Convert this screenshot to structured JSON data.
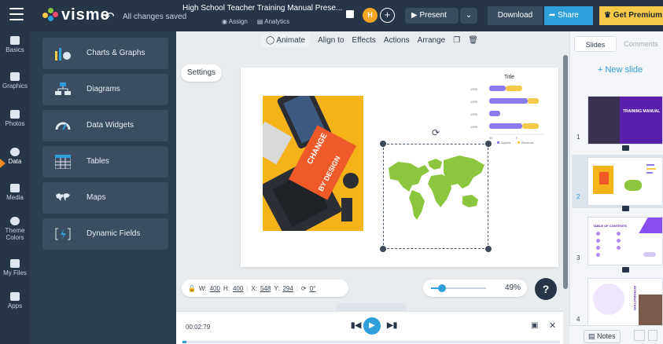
{
  "app": {
    "logo": "visme",
    "save_status": "All changes saved",
    "doc_title": "High School Teacher Training Manual Prese...",
    "assign_label": "Assign",
    "analytics_label": "Analytics",
    "avatar_initial": "H",
    "present_label": "Present",
    "download_label": "Download",
    "share_label": "Share",
    "premium_label": "Get Premium"
  },
  "sidebar": {
    "items": [
      {
        "label": "Basics"
      },
      {
        "label": "Graphics"
      },
      {
        "label": "Photos"
      },
      {
        "label": "Data"
      },
      {
        "label": "Media"
      },
      {
        "label": "Theme Colors"
      },
      {
        "label": "My Files"
      },
      {
        "label": "Apps"
      }
    ],
    "active": "Data"
  },
  "data_panel": {
    "items": [
      {
        "label": "Charts & Graphs"
      },
      {
        "label": "Diagrams"
      },
      {
        "label": "Data Widgets"
      },
      {
        "label": "Tables"
      },
      {
        "label": "Maps"
      },
      {
        "label": "Dynamic Fields"
      }
    ]
  },
  "context_toolbar": {
    "animate": "Animate",
    "align_to": "Align to",
    "effects": "Effects",
    "actions": "Actions",
    "arrange": "Arrange"
  },
  "canvas": {
    "settings_label": "Settings",
    "photo_text_1": "CHANGE",
    "photo_text_2": "BY DESIGN",
    "mini_chart": {
      "title": "Title",
      "categories": [
        "1994",
        "1995",
        "1996",
        "1999"
      ],
      "series": [
        {
          "values": [
            3,
            7,
            2,
            6
          ],
          "color": "#8a7cf0"
        },
        {
          "values": [
            3,
            2,
            0,
            3
          ],
          "color": "#f7c948"
        }
      ],
      "legend": [
        "Apples",
        "Bananas"
      ],
      "axis_ticks": [
        "50",
        "0"
      ]
    }
  },
  "dimensions": {
    "w_label": "W:",
    "w_value": "400",
    "h_label": "H:",
    "h_value": "400",
    "x_label": "X:",
    "x_value": "548",
    "y_label": "Y:",
    "y_value": "294",
    "rotation": "0°"
  },
  "zoom": {
    "value": "49%",
    "fraction": 0.2
  },
  "help_label": "?",
  "timeline": {
    "time": "00:02:79",
    "progress": 0.01
  },
  "right_panel": {
    "tabs": [
      {
        "label": "Slides"
      },
      {
        "label": "Comments"
      }
    ],
    "new_slide_label": "+ New slide",
    "thumbnails": [
      {
        "number": "1",
        "title": "TRAINING MANUAL"
      },
      {
        "number": "2"
      },
      {
        "number": "3",
        "title": "TABLE OF CONTENTS"
      },
      {
        "number": "4",
        "title": "INTRODUCTION"
      }
    ],
    "notes_label": "Notes"
  },
  "colors": {
    "topbar": "#263547",
    "accent": "#2e9fd9",
    "premium": "#f7c948",
    "active_marker": "#f28b1f",
    "map_green": "#8cc63f"
  }
}
